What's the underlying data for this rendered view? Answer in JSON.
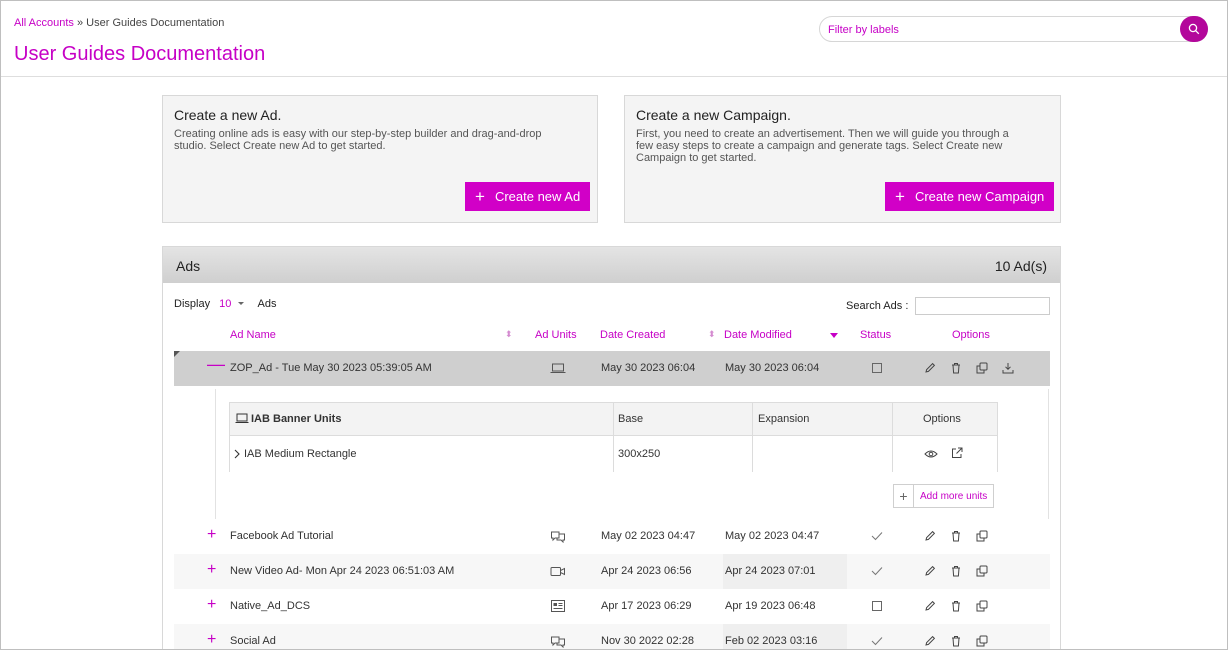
{
  "header": {
    "breadcrumb_root": "All Accounts",
    "breadcrumb_sep": "»",
    "breadcrumb_current": "User Guides Documentation",
    "title": "User Guides Documentation",
    "filter_placeholder": "Filter by labels"
  },
  "cards": {
    "ad": {
      "title": "Create a new Ad.",
      "text_line1": "Creating online ads is easy with our step-by-step builder and drag-and-drop",
      "text_line2": "studio. Select Create new Ad to get started.",
      "button": "Create new Ad"
    },
    "campaign": {
      "title": "Create a new Campaign.",
      "text_line1": "First, you need to create an advertisement. Then we will guide you through a",
      "text_line2": "few easy steps to create a campaign and generate tags. Select Create new",
      "text_line3": "Campaign to get started.",
      "button": "Create new Campaign"
    }
  },
  "ads": {
    "title": "Ads",
    "count": "10 Ad(s)",
    "display_label": "Display",
    "display_value": "10",
    "display_suffix": "Ads",
    "search_label": "Search Ads :",
    "columns": {
      "name": "Ad Name",
      "units": "Ad Units",
      "created": "Date Created",
      "modified": "Date Modified",
      "status": "Status",
      "options": "Options"
    },
    "rows": [
      {
        "name": "ZOP_Ad - Tue May 30 2023 05:39:05 AM",
        "unit_icon": "laptop-icon",
        "created": "May 30 2023 06:04",
        "modified": "May 30 2023 06:04",
        "status": "unchecked"
      },
      {
        "name": "Facebook Ad Tutorial",
        "unit_icon": "chat-icon",
        "created": "May 02 2023 04:47",
        "modified": "May 02 2023 04:47",
        "status": "checked"
      },
      {
        "name": "New Video Ad- Mon Apr 24 2023 06:51:03 AM",
        "unit_icon": "video-icon",
        "created": "Apr 24 2023 06:56",
        "modified": "Apr 24 2023 07:01",
        "status": "checked"
      },
      {
        "name": "Native_Ad_DCS",
        "unit_icon": "native-card-icon",
        "created": "Apr 17 2023 06:29",
        "modified": "Apr 19 2023 06:48",
        "status": "unchecked"
      },
      {
        "name": "Social Ad",
        "unit_icon": "chat-icon",
        "created": "Nov 30 2022 02:28",
        "modified": "Feb 02 2023 03:16",
        "status": "checked"
      }
    ],
    "units": {
      "header_name": "IAB Banner Units",
      "header_base": "Base",
      "header_expansion": "Expansion",
      "header_options": "Options",
      "row_name": "IAB Medium Rectangle",
      "row_base": "300x250",
      "add_more": "Add more units"
    }
  }
}
